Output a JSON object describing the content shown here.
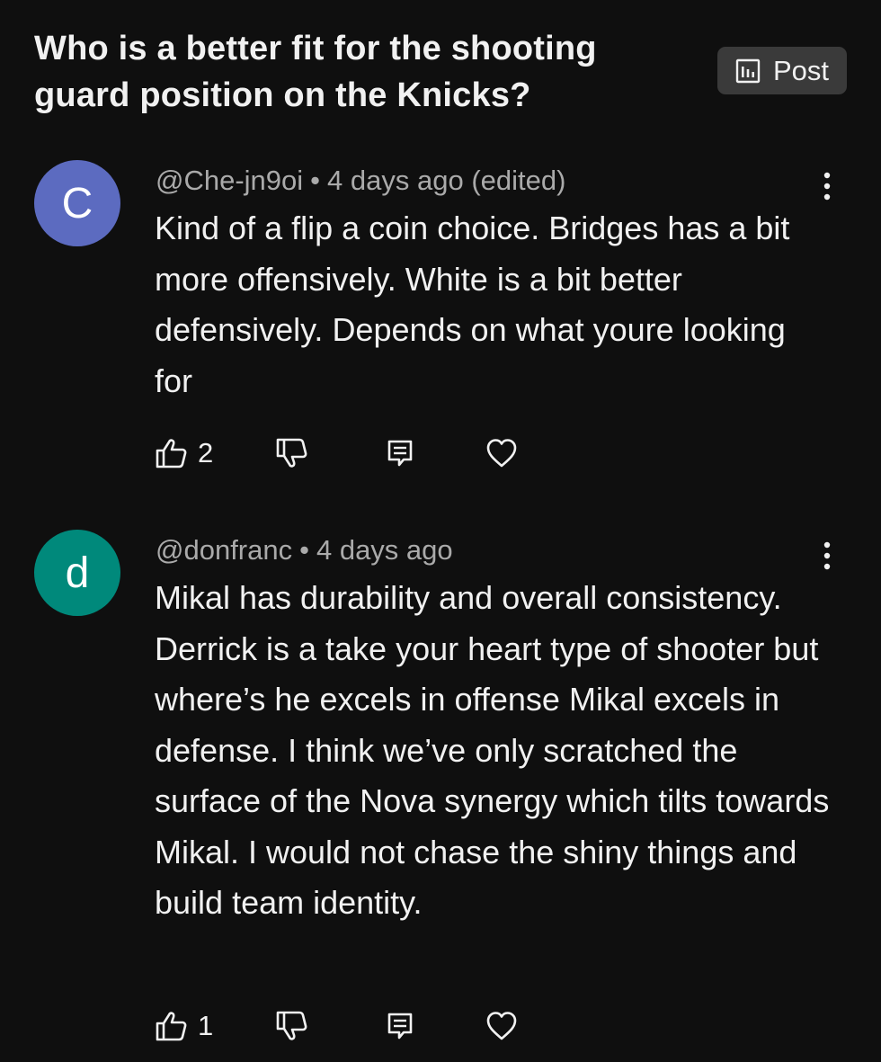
{
  "header": {
    "question": "Who is a better fit for the shooting guard position on the Knicks?",
    "post_label": "Post"
  },
  "colors": {
    "background": "#0f0f0f",
    "avatar_c": "#5c6bc0",
    "avatar_d": "#00897b",
    "post_button": "#3a3a3a"
  },
  "comments": [
    {
      "avatar_letter": "C",
      "handle": "@Che-jn9oi",
      "time": "4 days ago (edited)",
      "text": "Kind of a flip a coin choice. Bridges has a bit more offensively. White is a bit better defensively. Depends on what youre looking for",
      "likes": "2"
    },
    {
      "avatar_letter": "d",
      "handle": "@donfranc",
      "time": "4 days ago",
      "text": "Mikal has durability and overall consistency. Derrick is a take your heart type of shooter but where’s he excels in offense Mikal excels in defense. I think we’ve only scratched the surface of the Nova synergy which tilts towards Mikal. I would not chase the shiny things and build team identity.",
      "likes": "1"
    }
  ],
  "icons": {
    "post": "poll-chart-icon",
    "more": "more-vert-icon",
    "like": "thumb-up-icon",
    "dislike": "thumb-down-icon",
    "reply": "reply-comment-icon",
    "heart": "heart-icon"
  }
}
